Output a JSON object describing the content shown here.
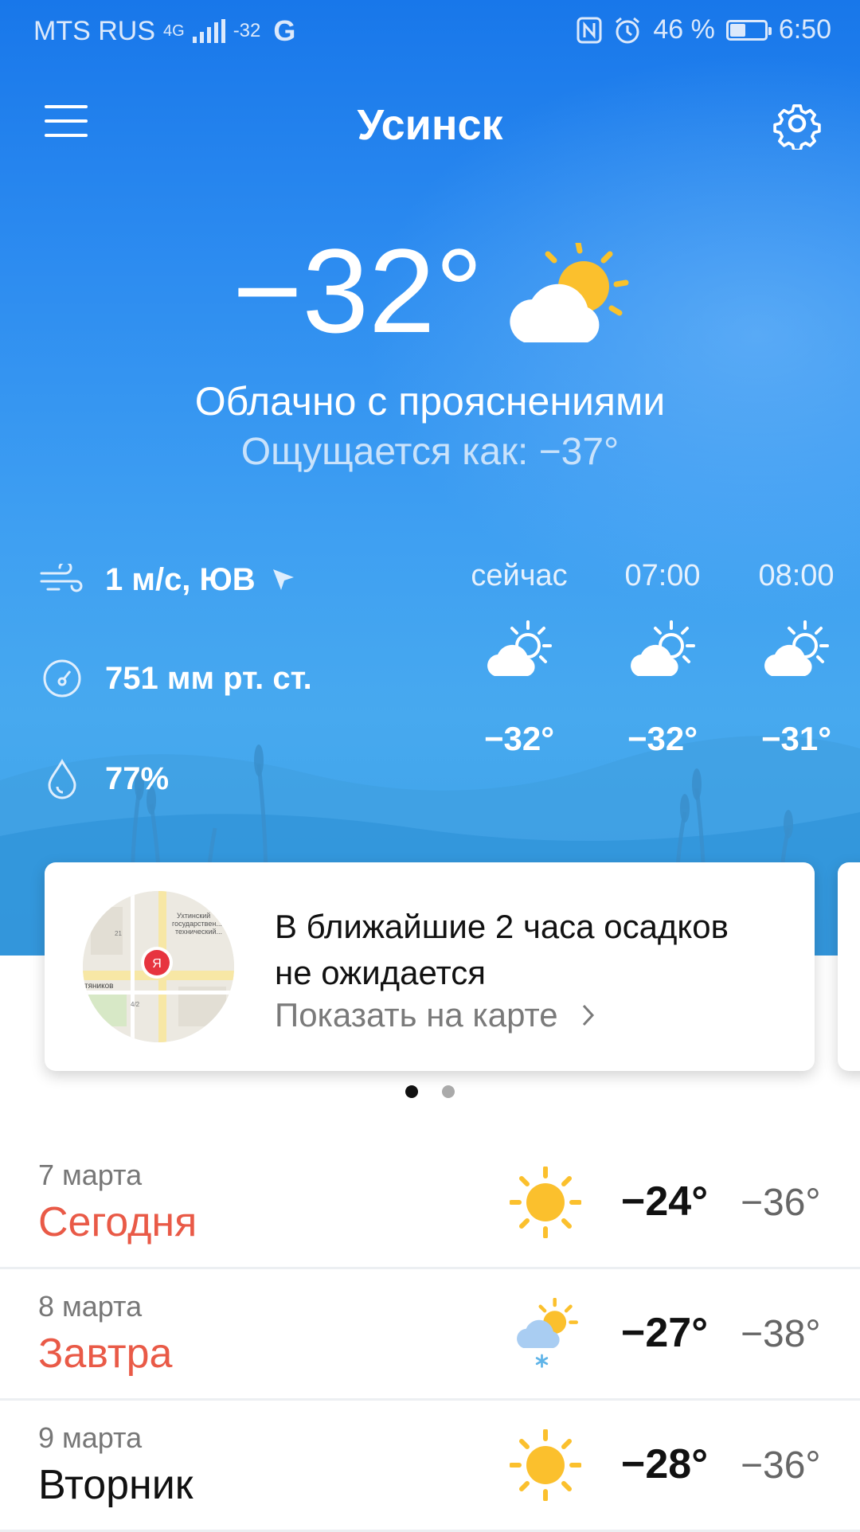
{
  "status_bar": {
    "carrier": "MTS RUS",
    "network": "4G",
    "temp_small": "-32",
    "g_logo": "G",
    "battery": "46 %",
    "battery_level": 0.46,
    "time": "6:50"
  },
  "header": {
    "city": "Усинск",
    "menu_icon": "menu-icon",
    "settings_icon": "gear-icon"
  },
  "current": {
    "temp": "−32°",
    "condition": "Облачно с прояснениями",
    "feels_like": "Ощущается как: −37°",
    "wind": "1 м/с, ЮВ",
    "pressure": "751 мм рт. ст.",
    "humidity": "77%"
  },
  "hourly": [
    {
      "label": "сейчас",
      "temp": "−32°"
    },
    {
      "label": "07:00",
      "temp": "−32°"
    },
    {
      "label": "08:00",
      "temp": "−31°"
    }
  ],
  "nowcast": {
    "title": "В ближайшие 2 часа осадков не ожидается",
    "link": "Показать на карте",
    "map_pin": "Я",
    "map_text_1": "Ухтинский",
    "map_text_2": "государствен...",
    "map_text_3": "технический...",
    "map_street": "тяников",
    "map_num_1": "21",
    "map_num_2": "4/2"
  },
  "days": [
    {
      "date": "7 марта",
      "name": "Сегодня",
      "high": "−24°",
      "low": "−36°",
      "icon": "sun",
      "accent": true
    },
    {
      "date": "8 марта",
      "name": "Завтра",
      "high": "−27°",
      "low": "−38°",
      "icon": "cloud-sun-snow",
      "accent": true
    },
    {
      "date": "9 марта",
      "name": "Вторник",
      "high": "−28°",
      "low": "−36°",
      "icon": "sun",
      "accent": false
    }
  ],
  "colors": {
    "accent": "#e95a47",
    "sky": "#2d8cf0",
    "sun": "#fbc02d"
  }
}
